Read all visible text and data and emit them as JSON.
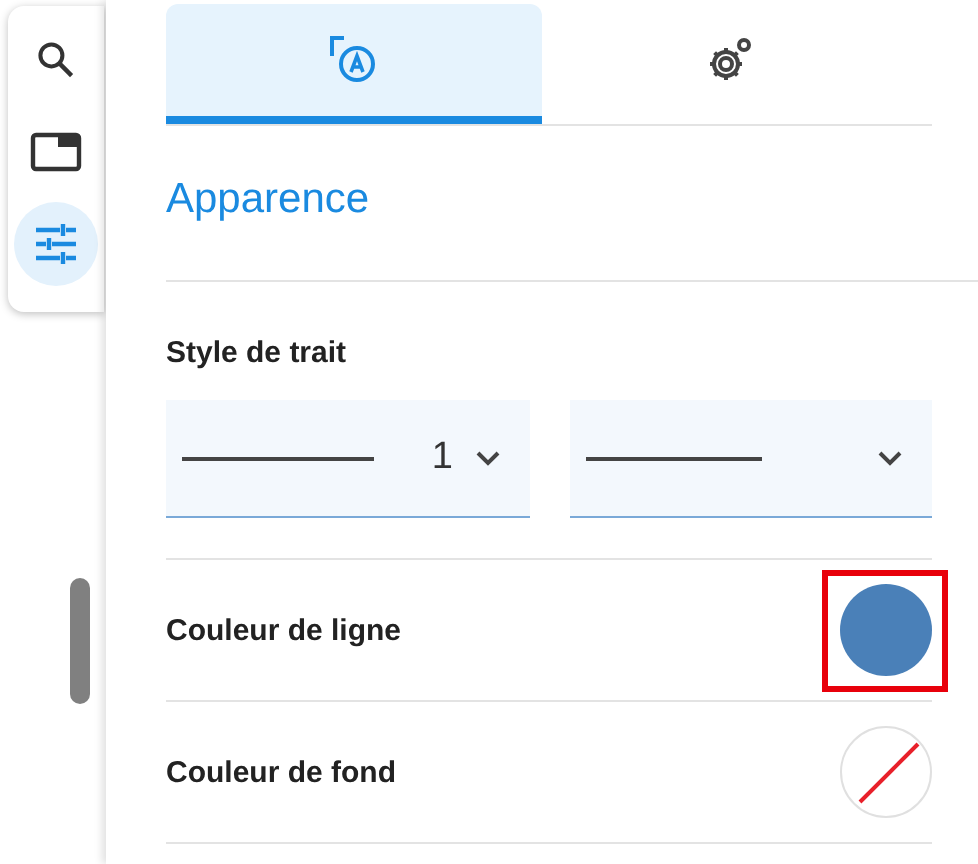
{
  "toolbar": {
    "items": [
      {
        "kind": "search",
        "selected": false
      },
      {
        "kind": "panel",
        "selected": false
      },
      {
        "kind": "sliders",
        "selected": true
      }
    ]
  },
  "tabs": [
    {
      "kind": "appearance",
      "selected": true
    },
    {
      "kind": "gears",
      "selected": false
    }
  ],
  "section_title": "Apparence",
  "stroke_style": {
    "label": "Style de trait",
    "selects": [
      {
        "kind": "width",
        "value": "1"
      },
      {
        "kind": "dash"
      }
    ]
  },
  "color_rows": [
    {
      "label": "Couleur de ligne",
      "kind": "filled",
      "color": "#4a80b8",
      "highlighted": true
    },
    {
      "label": "Couleur de fond",
      "kind": "none",
      "highlighted": false
    }
  ]
}
